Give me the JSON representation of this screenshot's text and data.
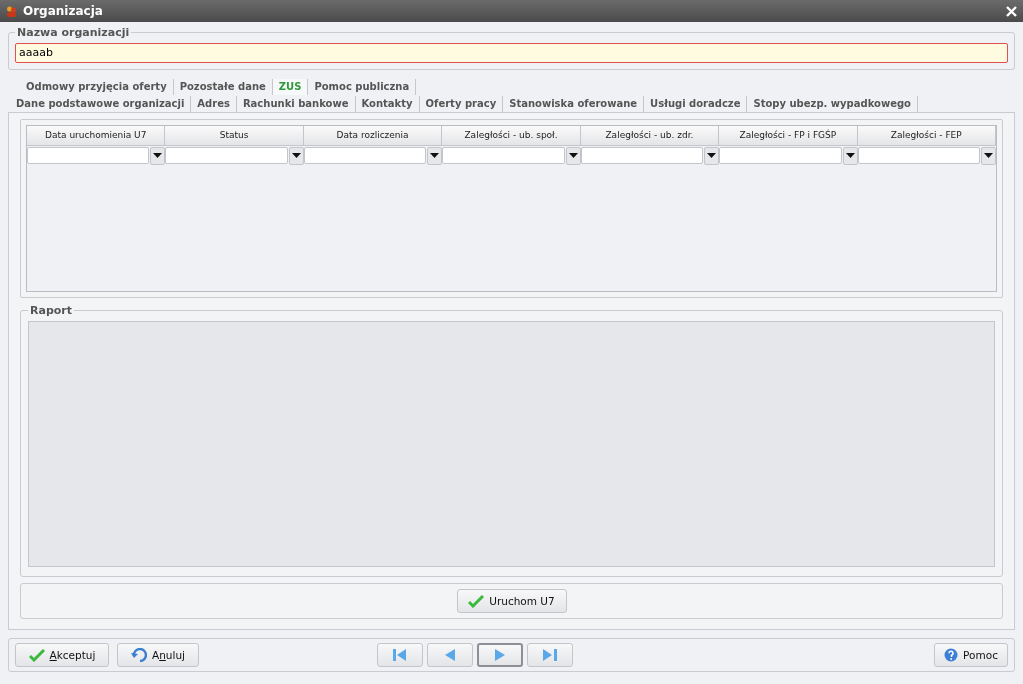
{
  "window": {
    "title": "Organizacja"
  },
  "name_group": {
    "title": "Nazwa organizacji",
    "value": "aaaab"
  },
  "tab_rows": [
    [
      {
        "label": "Odmowy przyjęcia oferty",
        "selected": false
      },
      {
        "label": "Pozostałe dane",
        "selected": false
      },
      {
        "label": "ZUS",
        "selected": true
      },
      {
        "label": "Pomoc publiczna",
        "selected": false
      }
    ],
    [
      {
        "label": "Dane podstawowe organizacji",
        "selected": false
      },
      {
        "label": "Adres",
        "selected": false
      },
      {
        "label": "Rachunki bankowe",
        "selected": false
      },
      {
        "label": "Kontakty",
        "selected": false
      },
      {
        "label": "Oferty pracy",
        "selected": false
      },
      {
        "label": "Stanowiska oferowane",
        "selected": false
      },
      {
        "label": "Usługi doradcze",
        "selected": false
      },
      {
        "label": "Stopy ubezp. wypadkowego",
        "selected": false
      }
    ]
  ],
  "table": {
    "columns": [
      "Data uruchomienia U7",
      "Status",
      "Data rozliczenia",
      "Zaległości - ub. społ.",
      "Zaległości - ub. zdr.",
      "Zaległości - FP i FGŚP",
      "Zaległości - FEP"
    ]
  },
  "report": {
    "title": "Raport"
  },
  "run_button": {
    "label": "Uruchom U7"
  },
  "footer": {
    "accept": {
      "label": [
        {
          "text": "A",
          "underline": true
        },
        {
          "text": "kceptuj",
          "underline": false
        }
      ]
    },
    "cancel": {
      "label": [
        {
          "text": "A",
          "underline": false
        },
        {
          "text": "n",
          "underline": true
        },
        {
          "text": "uluj",
          "underline": false
        }
      ]
    },
    "nav": [
      {
        "kind": "first",
        "focused": false
      },
      {
        "kind": "prev",
        "focused": false
      },
      {
        "kind": "next",
        "focused": true
      },
      {
        "kind": "last",
        "focused": false
      }
    ],
    "help": {
      "label": "Pomoc"
    }
  }
}
